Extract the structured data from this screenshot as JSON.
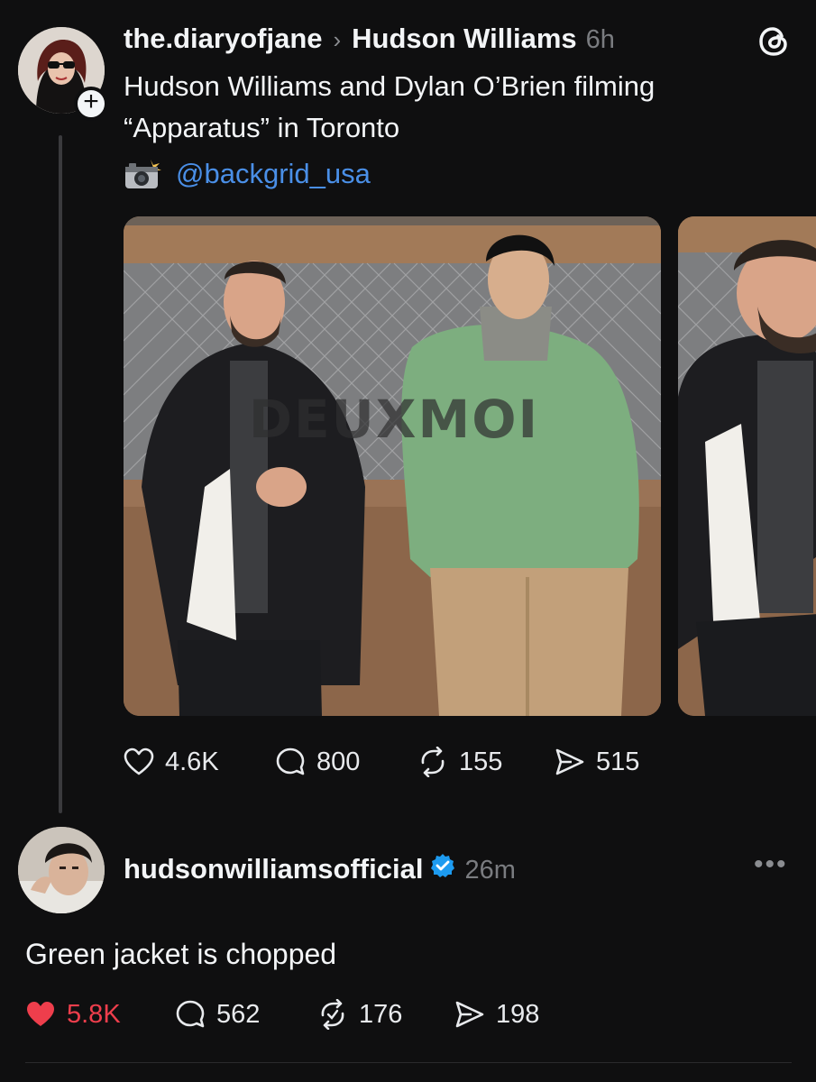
{
  "post": {
    "author": "the.diaryofjane",
    "target": "Hudson Williams",
    "time": "6h",
    "text_line1": "Hudson Williams and Dylan O’Brien filming",
    "text_line2": "“Apparatus” in Toronto",
    "credit_handle": "@backgrid_usa",
    "watermark": "DEUXMOI",
    "stats": {
      "likes": "4.6K",
      "replies": "800",
      "reposts": "155",
      "shares": "515"
    }
  },
  "reply": {
    "author": "hudsonwilliamsofficial",
    "time": "26m",
    "text": "Green jacket is chopped",
    "stats": {
      "likes": "5.8K",
      "replies": "562",
      "reposts": "176",
      "shares": "198"
    }
  },
  "colors": {
    "background": "#0f0f10",
    "link": "#4a8fe7",
    "liked": "#ee3e4c",
    "verified": "#1d9bf0"
  },
  "icons": [
    "threads-logo-icon",
    "plus-icon",
    "camera-flash-icon",
    "heart-icon",
    "comment-icon",
    "repost-icon",
    "share-icon",
    "verified-icon",
    "more-icon"
  ]
}
